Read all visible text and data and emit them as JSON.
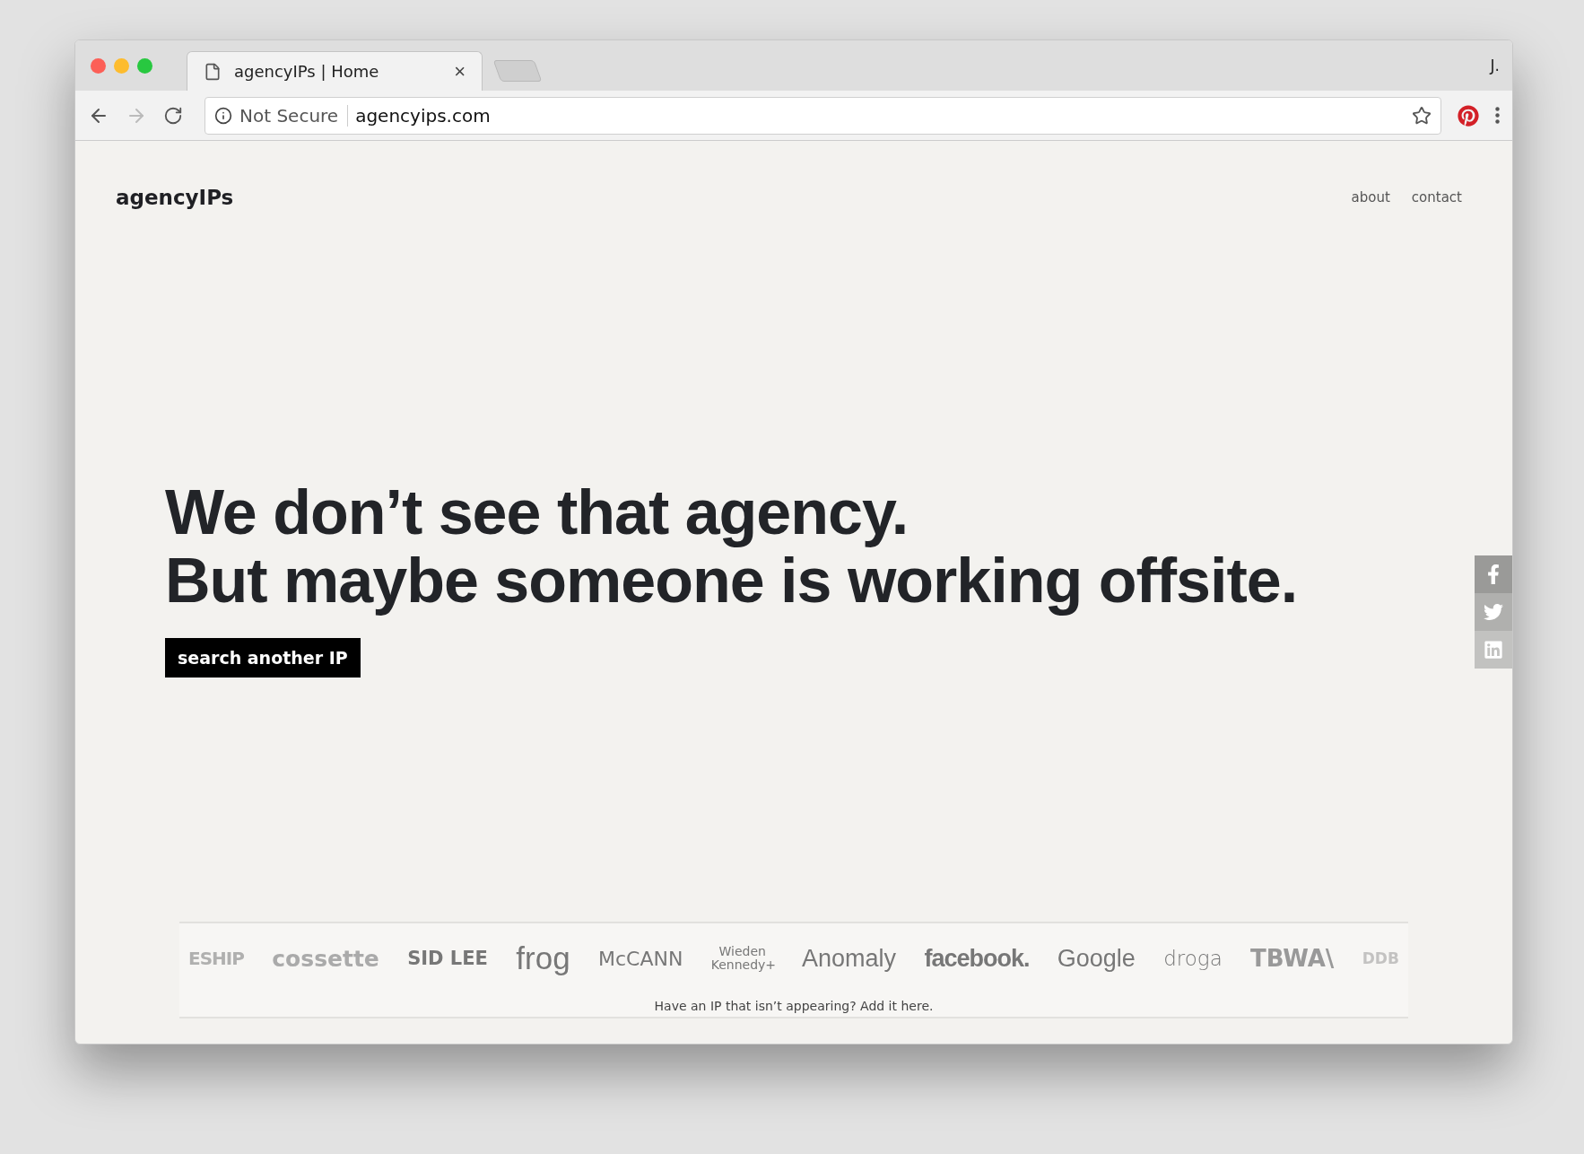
{
  "browser": {
    "tab_title": "agencyIPs | Home",
    "tab_close": "×",
    "profile": "J.",
    "security": "Not Secure",
    "url": "agencyips.com"
  },
  "site": {
    "logo": "agencyIPs",
    "nav": [
      {
        "label": "about"
      },
      {
        "label": "contact"
      }
    ]
  },
  "hero": {
    "lines": [
      "We don’t see that agency.",
      "But maybe someone is working offsite."
    ],
    "button": "search another IP"
  },
  "social": [
    {
      "kind": "facebook"
    },
    {
      "kind": "twitter"
    },
    {
      "kind": "linkedin"
    }
  ],
  "logos": [
    {
      "text": "ESHIP",
      "faded": true
    },
    {
      "text": "cossette",
      "faded": false
    },
    {
      "text": "SID LEE",
      "faded": false
    },
    {
      "text": "frog",
      "faded": false
    },
    {
      "text": "McCANN",
      "faded": false
    },
    {
      "text": "Wieden Kennedy+",
      "faded": false
    },
    {
      "text": "Anomaly",
      "faded": false
    },
    {
      "text": "facebook.",
      "faded": false
    },
    {
      "text": "Google",
      "faded": false
    },
    {
      "text": "droga",
      "faded": false
    },
    {
      "text": "TBWA\\",
      "faded": false
    },
    {
      "text": "DDB",
      "faded": true
    }
  ],
  "footer_note": "Have an IP that isn’t appearing? Add it here."
}
